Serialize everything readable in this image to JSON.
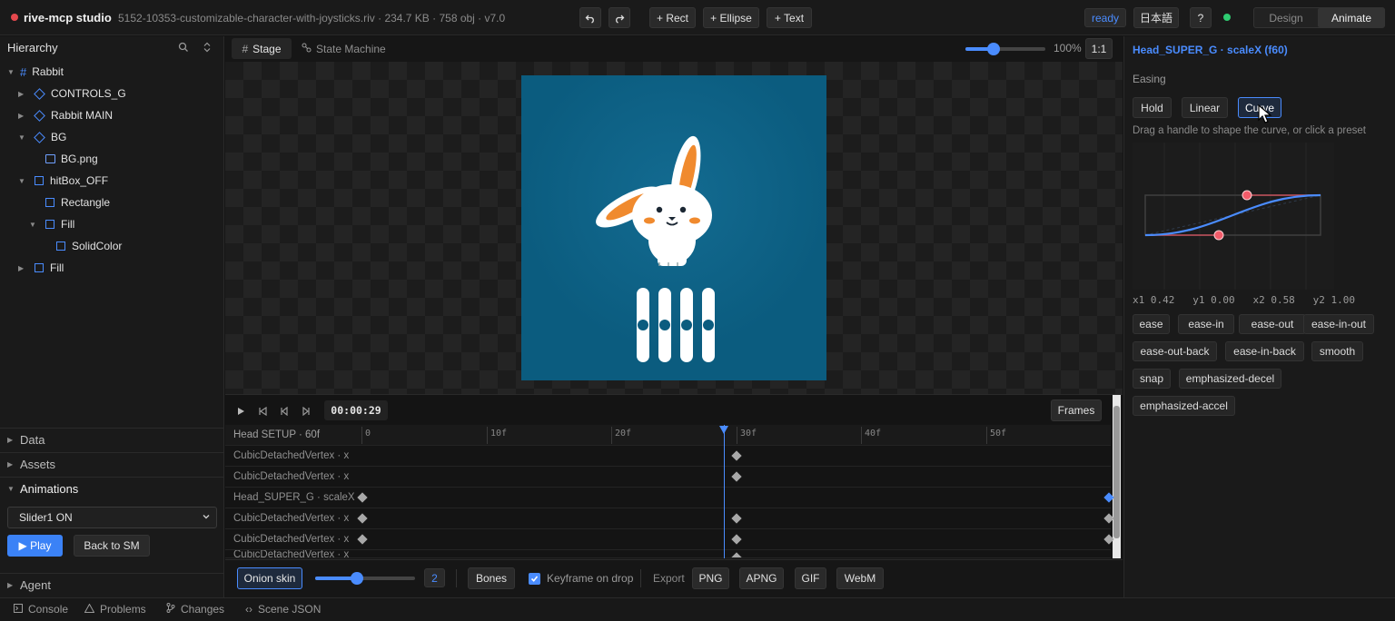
{
  "app": {
    "name": "rive-mcp studio",
    "file_info": "5152-10353-customizable-character-with-joysticks.riv · 234.7 KB · 758 obj · v7.0",
    "status": "ready",
    "language": "日本語",
    "help": "?",
    "modes": [
      "Design",
      "Animate"
    ],
    "tools": [
      "+ Rect",
      "+ Ellipse",
      "+ Text"
    ]
  },
  "hierarchy": {
    "title": "Hierarchy",
    "items": [
      {
        "label": "Rabbit",
        "icon": "artboard-icon"
      },
      {
        "label": "CONTROLS_G",
        "icon": "group-icon"
      },
      {
        "label": "Rabbit MAIN",
        "icon": "group-icon"
      },
      {
        "label": "BG",
        "icon": "group-icon"
      },
      {
        "label": "BG.png",
        "icon": "image-icon"
      },
      {
        "label": "hitBox_OFF",
        "icon": "shape-icon"
      },
      {
        "label": "Rectangle",
        "icon": "shape-icon"
      },
      {
        "label": "Fill",
        "icon": "shape-icon"
      },
      {
        "label": "SolidColor",
        "icon": "shape-icon"
      },
      {
        "label": "Fill",
        "icon": "shape-icon"
      }
    ]
  },
  "left_sections": {
    "data": "Data",
    "assets": "Assets",
    "animations": "Animations",
    "animation_selected": "Slider1 ON",
    "play": "▶ Play",
    "back": "Back to SM",
    "agent": "Agent"
  },
  "center": {
    "tabs": [
      "Stage",
      "State Machine"
    ],
    "zoom": "100%",
    "zoom_reset": "1:1",
    "zoom_level": 0.35
  },
  "timeline": {
    "time": "00:00:29",
    "frames_btn": "Frames",
    "header": "Head SETUP · 60f",
    "ticks": [
      "0",
      "10f",
      "20f",
      "30f",
      "40f",
      "50f"
    ],
    "tracks": [
      "CubicDetachedVertex · x",
      "CubicDetachedVertex · x",
      "Head_SUPER_G · scaleX",
      "CubicDetachedVertex · x",
      "CubicDetachedVertex · x",
      "CubicDetachedVertex · x"
    ]
  },
  "toolbar": {
    "onion": "Onion skin",
    "onion_count": "2",
    "onion_level": 0.42,
    "bones": "Bones",
    "keyframe_on_drop": "Keyframe on drop",
    "export_label": "Export",
    "exports": [
      "PNG",
      "APNG",
      "GIF",
      "WebM"
    ]
  },
  "inspector": {
    "title": "Head_SUPER_G · scaleX (f60)",
    "easing_label": "Easing",
    "easing_modes": [
      "Hold",
      "Linear",
      "Curve"
    ],
    "hint": "Drag a handle to shape the curve, or click a preset",
    "curve_values": "x1 0.42   y1 0.00   x2 0.58   y2 1.00",
    "presets": [
      "ease",
      "ease-in",
      "ease-out",
      "ease-in-out",
      "ease-out-back",
      "ease-in-back",
      "smooth",
      "snap",
      "emphasized-decel",
      "emphasized-accel"
    ]
  },
  "bottom_tabs": [
    "Console",
    "Problems",
    "Changes",
    "Scene JSON"
  ],
  "colors": {
    "accent": "#4a8cff",
    "art_bg": "#0b5c7f",
    "status": "#2ecc71"
  }
}
